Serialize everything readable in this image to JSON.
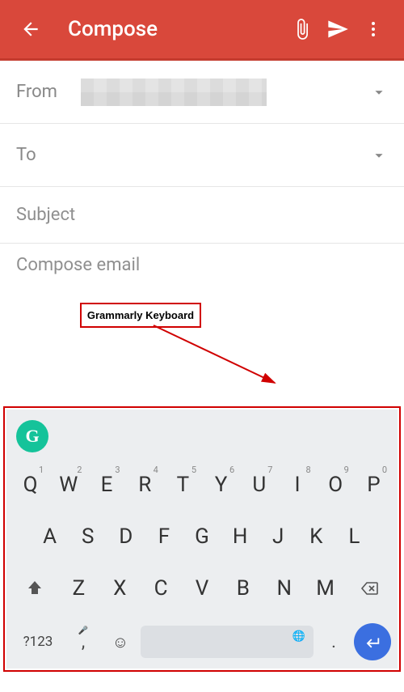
{
  "header": {
    "title": "Compose",
    "icons": {
      "back": "arrow-left",
      "attach": "paperclip",
      "send": "send",
      "more": "more-vert"
    }
  },
  "fields": {
    "from_label": "From",
    "to_label": "To",
    "subject_placeholder": "Subject",
    "body_placeholder": "Compose email"
  },
  "annotation": {
    "label": "Grammarly Keyboard"
  },
  "keyboard": {
    "badge": "G",
    "row1": [
      {
        "k": "Q",
        "n": "1"
      },
      {
        "k": "W",
        "n": "2"
      },
      {
        "k": "E",
        "n": "3"
      },
      {
        "k": "R",
        "n": "4"
      },
      {
        "k": "T",
        "n": "5"
      },
      {
        "k": "Y",
        "n": "6"
      },
      {
        "k": "U",
        "n": "7"
      },
      {
        "k": "I",
        "n": "8"
      },
      {
        "k": "O",
        "n": "9"
      },
      {
        "k": "P",
        "n": "0"
      }
    ],
    "row2": [
      "A",
      "S",
      "D",
      "F",
      "G",
      "H",
      "J",
      "K",
      "L"
    ],
    "row3": [
      "Z",
      "X",
      "C",
      "V",
      "B",
      "N",
      "M"
    ],
    "sym_label": "?123",
    "comma": ",",
    "dot": "."
  }
}
